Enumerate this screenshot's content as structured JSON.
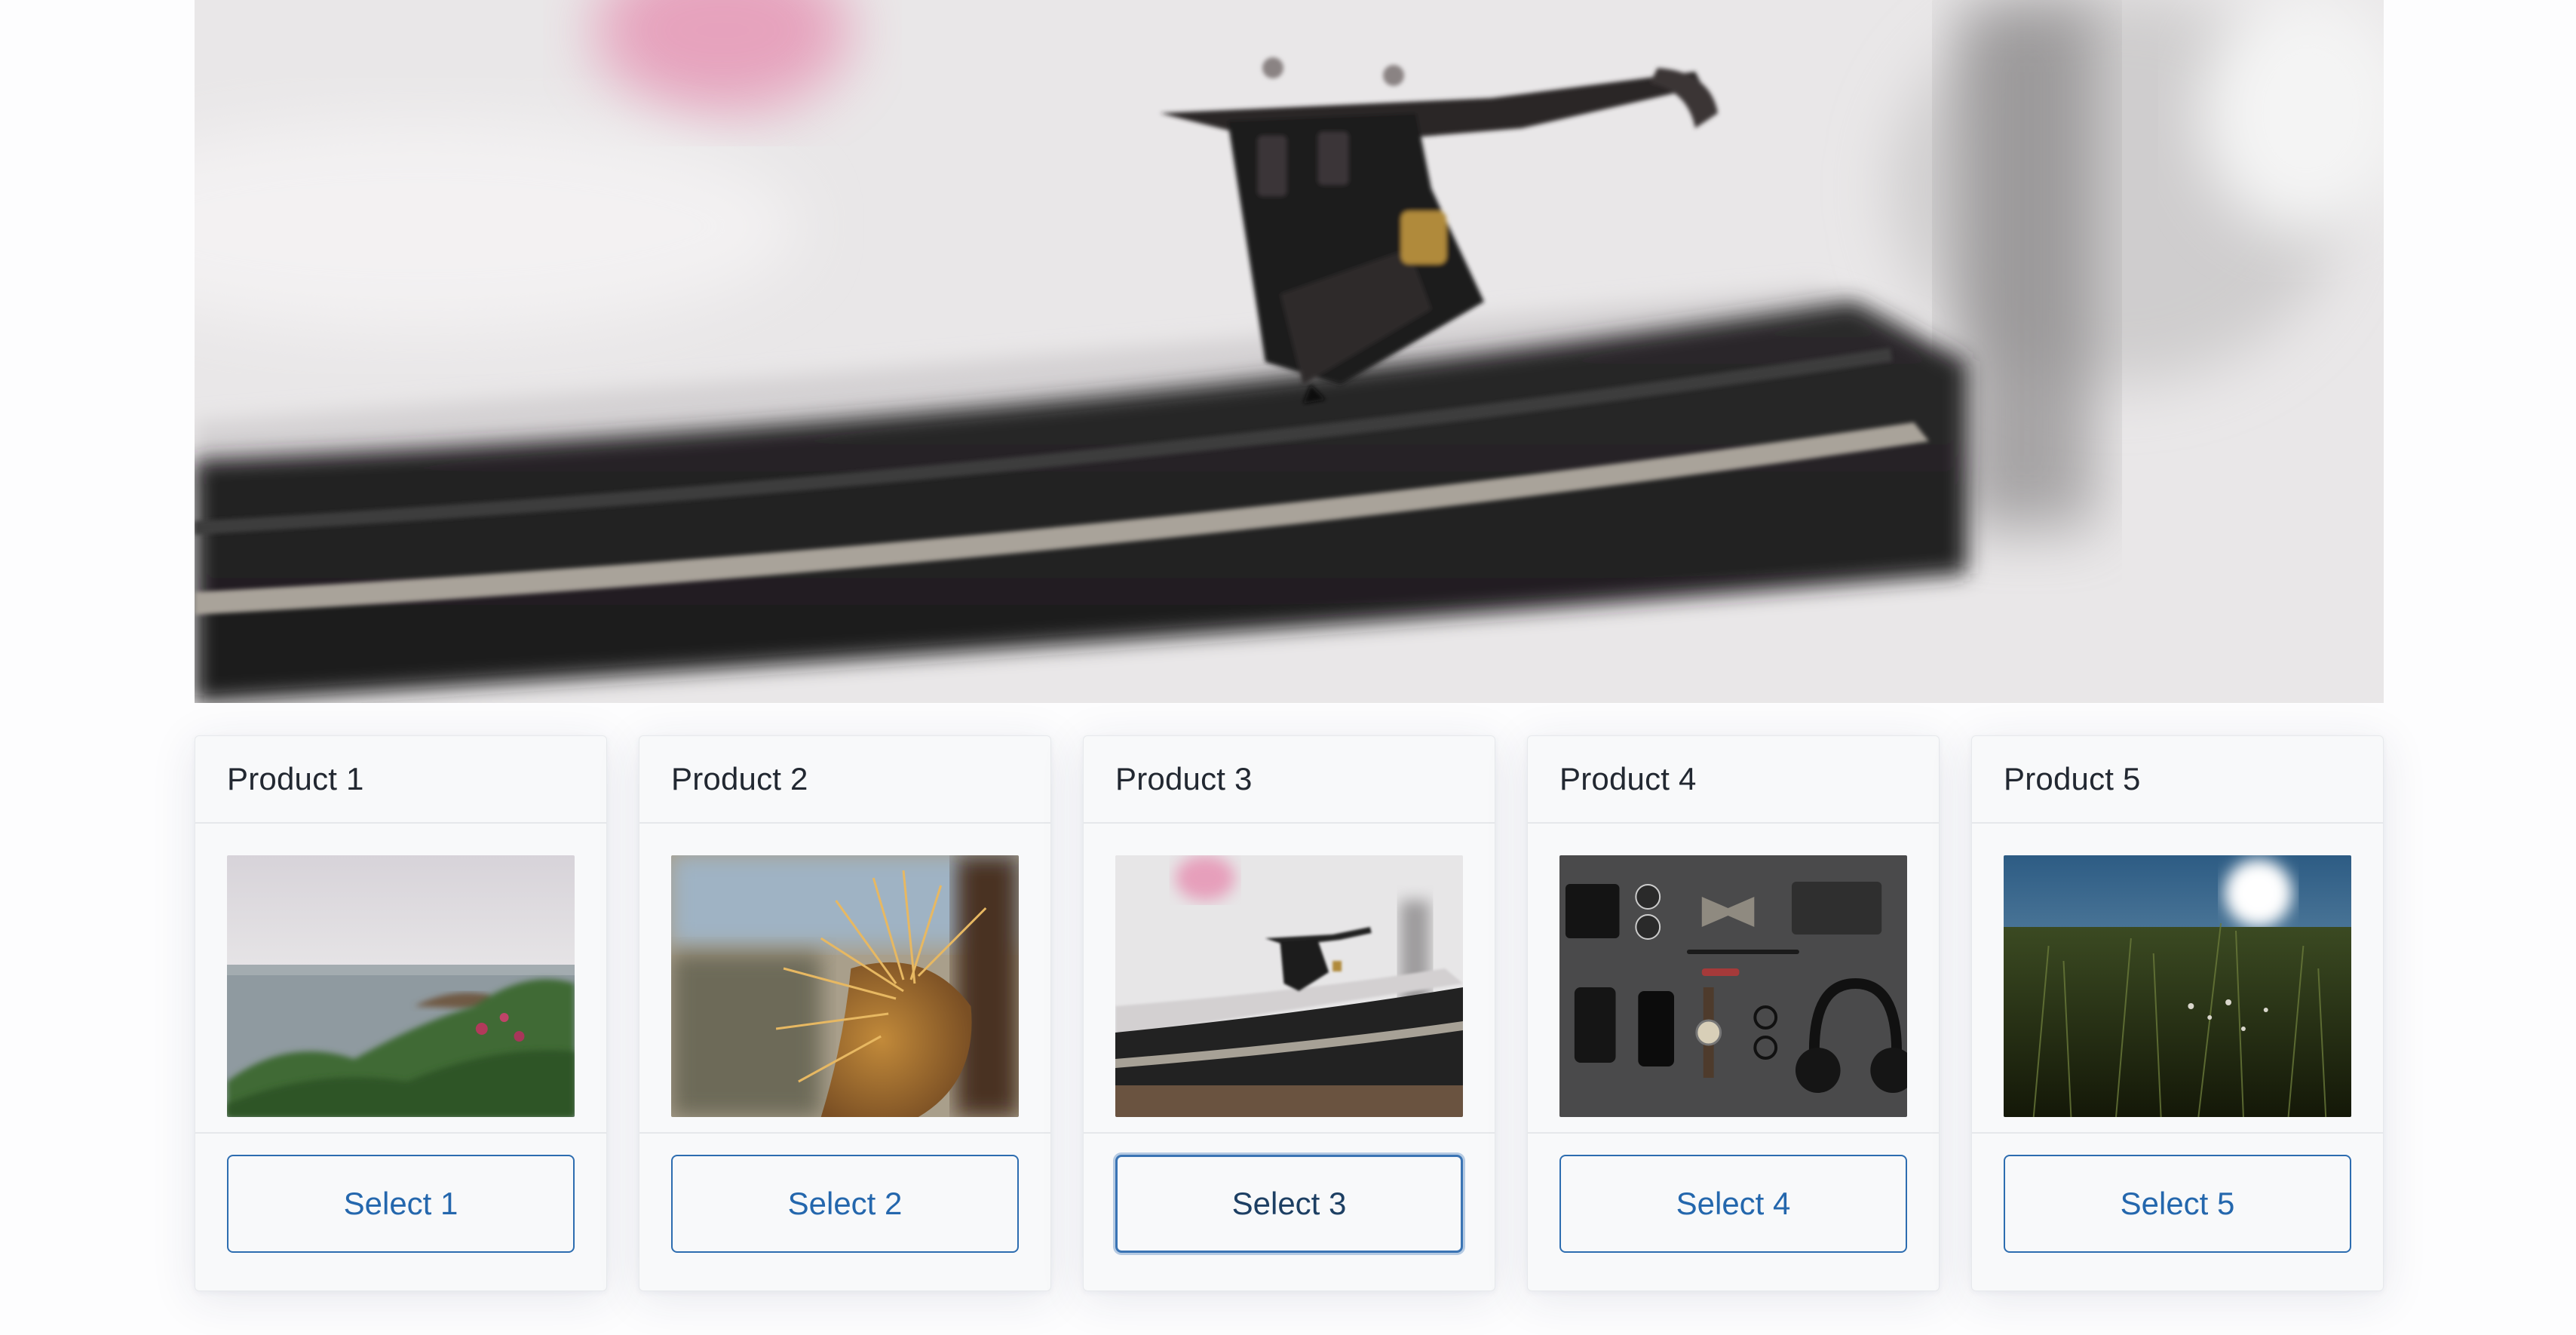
{
  "products": [
    {
      "title": "Product 1",
      "button_label": "Select 1",
      "image": "sea-coast-photo"
    },
    {
      "title": "Product 2",
      "button_label": "Select 2",
      "image": "cactus-spines-photo"
    },
    {
      "title": "Product 3",
      "button_label": "Select 3",
      "image": "turntable-photo",
      "focused": true
    },
    {
      "title": "Product 4",
      "button_label": "Select 4",
      "image": "flatlay-accessories-photo"
    },
    {
      "title": "Product 5",
      "button_label": "Select 5",
      "image": "sunlit-meadow-photo"
    }
  ],
  "hero": {
    "image": "turntable-stylus-photo"
  },
  "colors": {
    "accent": "#2467ad",
    "card_background": "#f8f9fa",
    "border": "#e6e8eb",
    "title_text": "#222831"
  }
}
